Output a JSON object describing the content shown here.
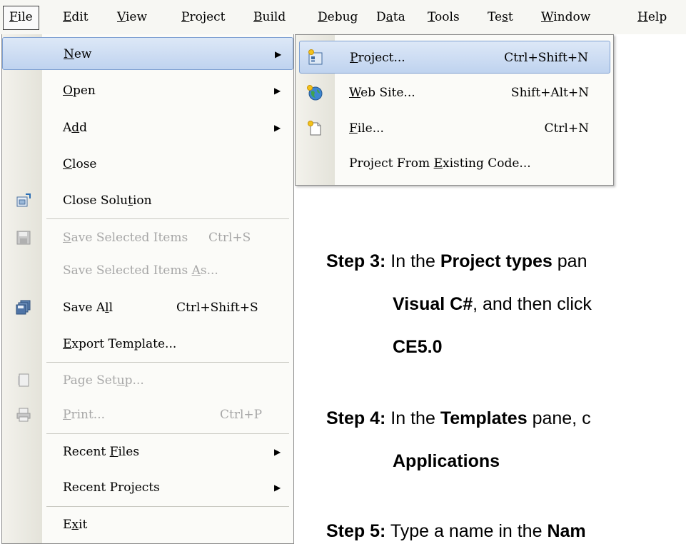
{
  "menubar": {
    "items": [
      {
        "pre": "",
        "u": "F",
        "post": "ile"
      },
      {
        "pre": "",
        "u": "E",
        "post": "dit"
      },
      {
        "pre": "",
        "u": "V",
        "post": "iew"
      },
      {
        "pre": "",
        "u": "P",
        "post": "roject"
      },
      {
        "pre": "",
        "u": "B",
        "post": "uild"
      },
      {
        "pre": "",
        "u": "D",
        "post": "ebug"
      },
      {
        "pre": "D",
        "u": "a",
        "post": "ta"
      },
      {
        "pre": "",
        "u": "T",
        "post": "ools"
      },
      {
        "pre": "Te",
        "u": "s",
        "post": "t"
      },
      {
        "pre": "",
        "u": "W",
        "post": "indow"
      },
      {
        "pre": "",
        "u": "H",
        "post": "elp"
      }
    ]
  },
  "file_menu": {
    "new": {
      "pre": "",
      "u": "N",
      "post": "ew"
    },
    "open": {
      "pre": "",
      "u": "O",
      "post": "pen"
    },
    "add": {
      "pre": "A",
      "u": "d",
      "post": "d"
    },
    "close": {
      "pre": "",
      "u": "C",
      "post": "lose"
    },
    "close_solution": {
      "pre": "Close Solu",
      "u": "t",
      "post": "ion"
    },
    "save_selected": {
      "pre": "",
      "u": "S",
      "post": "ave Selected Items",
      "shortcut": "Ctrl+S"
    },
    "save_selected_as": {
      "pre": "Save Selected Items ",
      "u": "A",
      "post": "s..."
    },
    "save_all": {
      "pre": "Save A",
      "u": "l",
      "post": "l",
      "shortcut": "Ctrl+Shift+S"
    },
    "export_template": {
      "pre": "",
      "u": "E",
      "post": "xport Template..."
    },
    "page_setup": {
      "pre": "Page Set",
      "u": "u",
      "post": "p..."
    },
    "print": {
      "pre": "",
      "u": "P",
      "post": "rint...",
      "shortcut": "Ctrl+P"
    },
    "recent_files": {
      "pre": "Recent ",
      "u": "F",
      "post": "iles"
    },
    "recent_projects": {
      "pre": "Recent Pro",
      "u": "j",
      "post": "ects"
    },
    "exit": {
      "pre": "E",
      "u": "x",
      "post": "it"
    }
  },
  "new_submenu": {
    "project": {
      "pre": "",
      "u": "P",
      "post": "roject...",
      "shortcut": "Ctrl+Shift+N"
    },
    "web_site": {
      "pre": "",
      "u": "W",
      "post": "eb Site...",
      "shortcut": "Shift+Alt+N"
    },
    "file": {
      "pre": "",
      "u": "F",
      "post": "ile...",
      "shortcut": "Ctrl+N"
    },
    "from_existing": {
      "pre": "Project From ",
      "u": "E",
      "post": "xisting Code..."
    }
  },
  "document": {
    "step3": {
      "label": "Step 3:",
      "t1": " In the ",
      "b1": "Project types",
      "t2": " pan",
      "b2": "Visual C#",
      "t3": ", and then click",
      "b3": "CE5.0"
    },
    "step4": {
      "label": "Step 4:",
      "t1": " In the ",
      "b1": "Templates",
      "t2": " pane, c",
      "b2": "Applications"
    },
    "step5": {
      "label": "Step 5:",
      "t1": " Type a name in the ",
      "b1": "Nam"
    }
  },
  "icons": {
    "close_solution": "close-solution-icon",
    "save": "save-icon",
    "save_all": "save-all-icon",
    "page_setup": "page-setup-icon",
    "print": "print-icon",
    "project": "project-icon",
    "web_site": "globe-icon",
    "file": "new-file-icon"
  }
}
